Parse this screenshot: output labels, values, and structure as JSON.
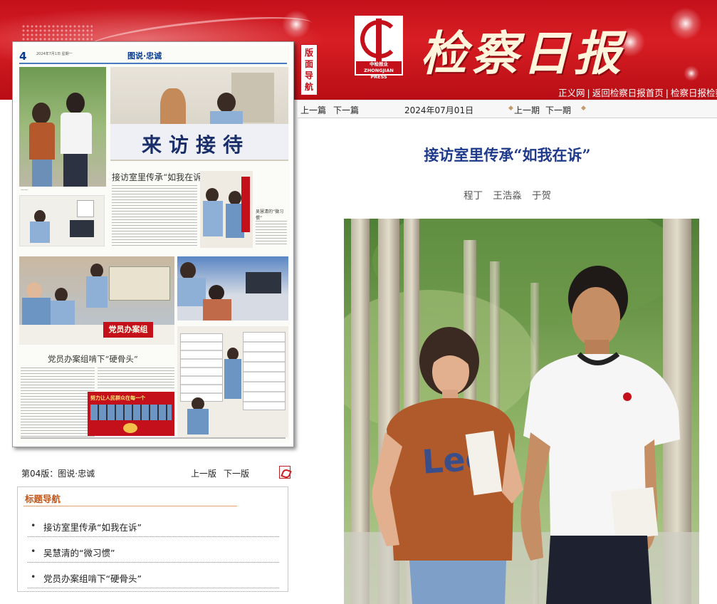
{
  "header": {
    "masthead": "检察日报",
    "logo_text": "中检报业 ZHONGJIAN PRESS",
    "links": [
      "正义网",
      "返回检察日报首页",
      "检察日报检察"
    ]
  },
  "nav_tab": "版面导航",
  "thumbnail": {
    "page_num": "4",
    "page_category": "图说·忠诚",
    "header_small": "2024年7月1日 星期一",
    "headline_1": "接访室里传承“如我在诉”",
    "banner_text": "来访接待",
    "side_caption": "吴慧清的“微习惯”",
    "headline_2": "党员办案组啃下“硬骨头”",
    "red_sign": "党员办案组",
    "red_banner": "努力让人民群众在每一个"
  },
  "page_nav": {
    "label": "第04版：图说·忠诚",
    "prev": "上一版",
    "next": "下一版",
    "pdf_icon": "pdf-icon"
  },
  "title_nav": {
    "heading": "标题导航",
    "items": [
      "接访室里传承“如我在诉”",
      "吴慧清的“微习惯”",
      "党员办案组啃下“硬骨头”"
    ]
  },
  "article_bar": {
    "prev_article": "上一篇",
    "next_article": "下一篇",
    "date": "2024年07月01日",
    "prev_issue": "上一期",
    "next_issue": "下一期"
  },
  "article": {
    "title": "接访室里传承“如我在诉”",
    "authors": "程丁 王浩淼 于贺"
  },
  "colors": {
    "brand_red": "#c4101a",
    "title_blue": "#1f3a8a",
    "nav_orange": "#c0561a"
  }
}
